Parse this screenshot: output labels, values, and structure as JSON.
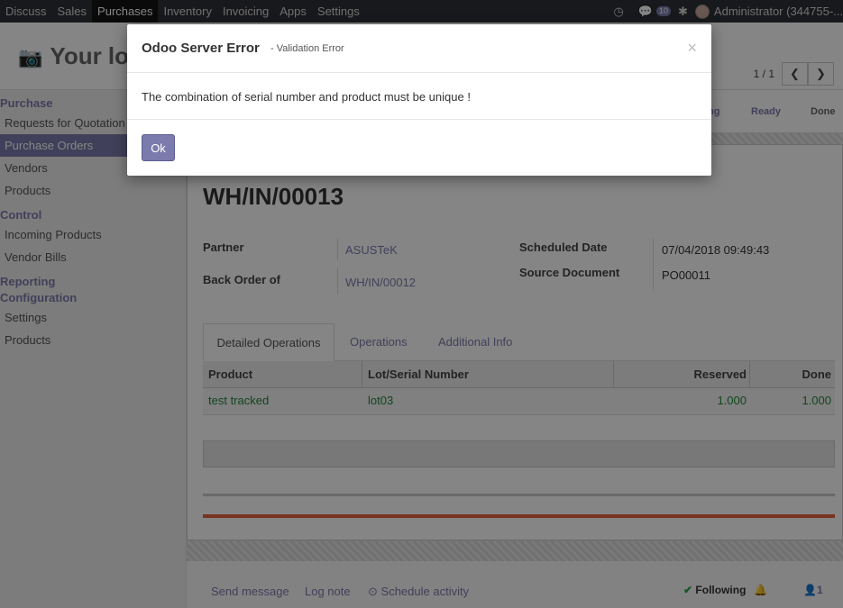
{
  "topbar": {
    "menu": [
      "Discuss",
      "Sales",
      "Purchases",
      "Inventory",
      "Invoicing",
      "Apps",
      "Settings"
    ],
    "active_menu": "Purchases",
    "message_count": "10",
    "user": "Administrator (344755-..."
  },
  "header": {
    "logo_text": "Your lo",
    "pager": "1 / 1"
  },
  "sidebar": {
    "sections": [
      {
        "title": "Purchase",
        "items": [
          "Requests for Quotation",
          "Purchase Orders",
          "Vendors",
          "Products"
        ]
      },
      {
        "title": "Control",
        "items": [
          "Incoming Products",
          "Vendor Bills"
        ]
      },
      {
        "title": "Reporting",
        "items": []
      },
      {
        "title": "Configuration",
        "items": [
          "Settings",
          "Products"
        ]
      }
    ],
    "active_item": "Purchase Orders"
  },
  "statusbar": {
    "stages": [
      "ng",
      "Ready",
      "Done"
    ],
    "current_stage": "Ready"
  },
  "record": {
    "name": "WH/IN/00013",
    "partner_label": "Partner",
    "partner_value": "ASUSTeK",
    "back_order_label": "Back Order of",
    "back_order_value": "WH/IN/00012",
    "scheduled_label": "Scheduled Date",
    "scheduled_value": "07/04/2018 09:49:43",
    "source_label": "Source Document",
    "source_value": "PO00011"
  },
  "tabs": [
    "Detailed Operations",
    "Operations",
    "Additional Info"
  ],
  "table": {
    "columns": [
      "Product",
      "Lot/Serial Number",
      "Reserved",
      "Done"
    ],
    "rows": [
      {
        "product": "test tracked",
        "lot": "lot03",
        "reserved": "1.000",
        "done": "1.000"
      }
    ]
  },
  "chatter": {
    "send_message": "Send message",
    "log_note": "Log note",
    "schedule_activity": "Schedule activity",
    "following": "Following",
    "followers": "1"
  },
  "modal": {
    "title": "Odoo Server Error",
    "subtitle": "- Validation Error",
    "close": "×",
    "message": "The combination of serial number and product must be unique !",
    "ok_label": "Ok"
  },
  "colors": {
    "accent": "#7c7bad",
    "navbar": "#2f3136",
    "link_green": "#22863a",
    "progress_red": "#e8623c"
  }
}
